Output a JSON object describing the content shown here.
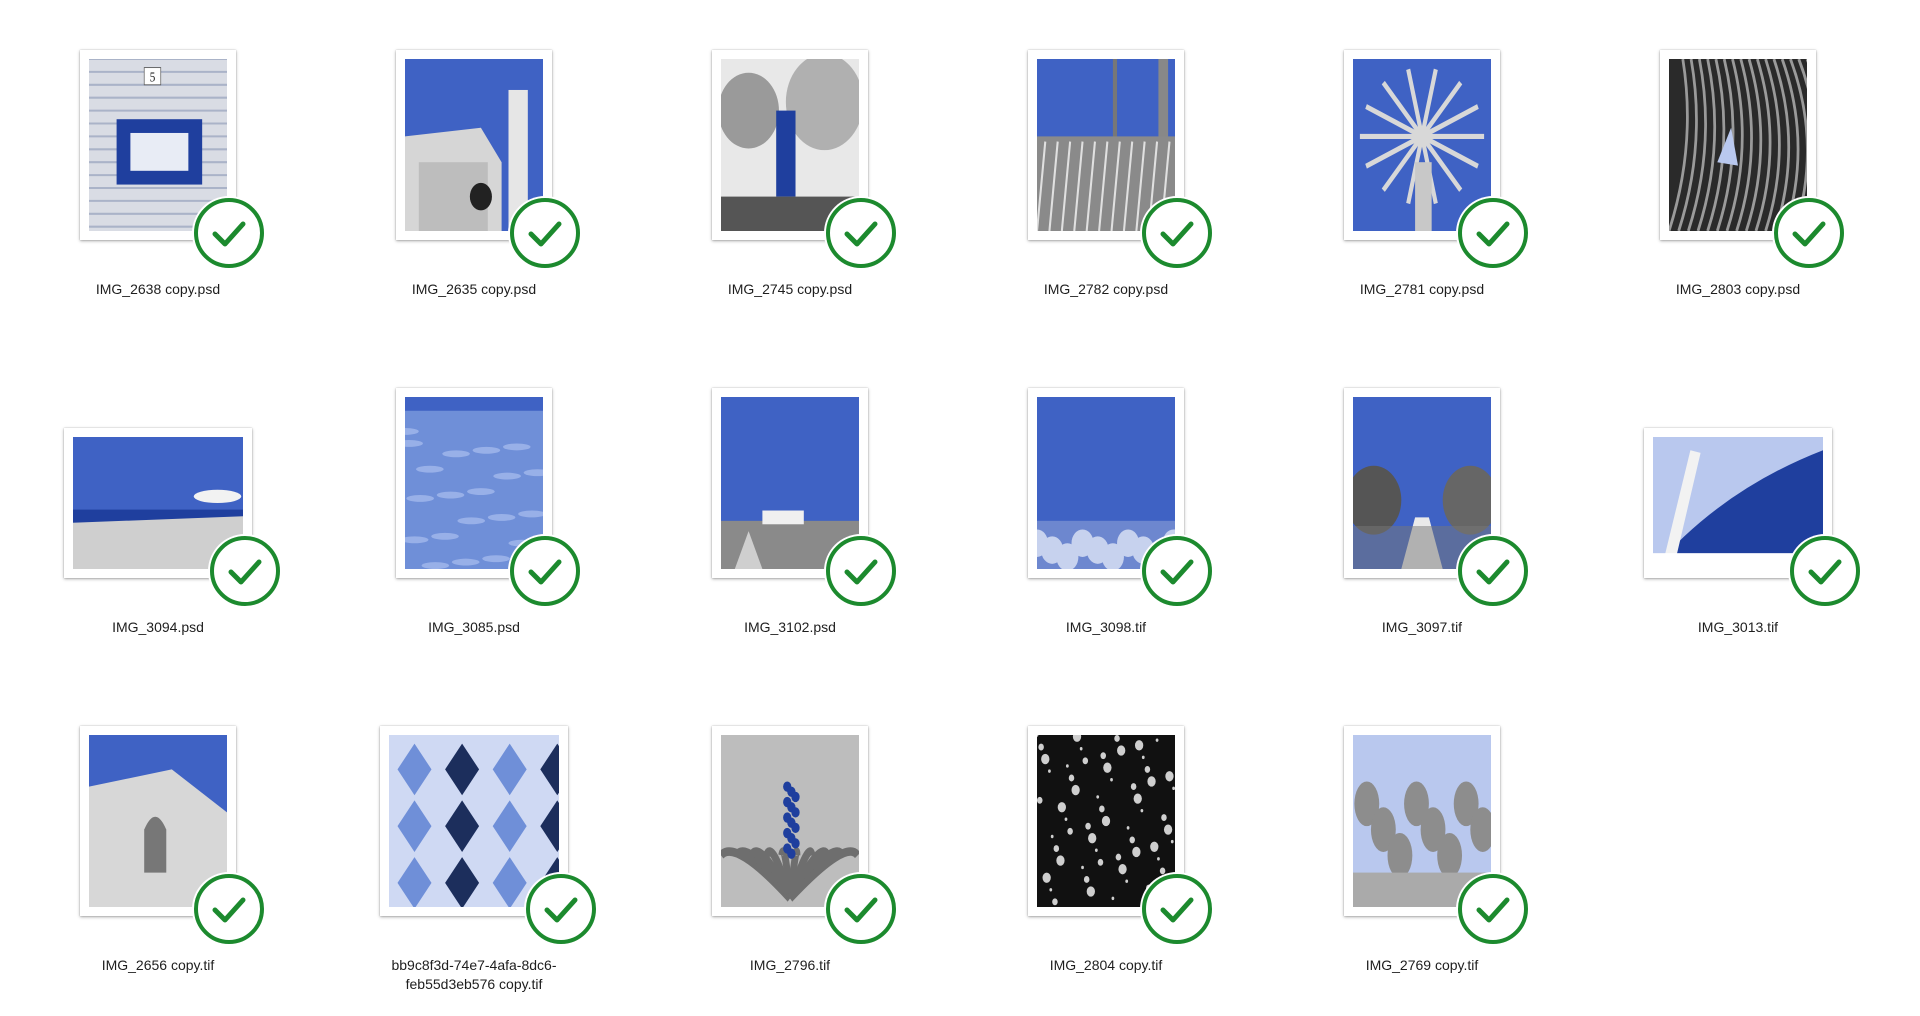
{
  "files": [
    {
      "name": "IMG_2638 copy.psd",
      "shape": "portrait",
      "scene": "tile-wall",
      "status": "checked"
    },
    {
      "name": "IMG_2635 copy.psd",
      "shape": "portrait",
      "scene": "church",
      "status": "checked"
    },
    {
      "name": "IMG_2745 copy.psd",
      "shape": "portrait",
      "scene": "lift-trees",
      "status": "checked"
    },
    {
      "name": "IMG_2782 copy.psd",
      "shape": "portrait",
      "scene": "agave-garden",
      "status": "checked"
    },
    {
      "name": "IMG_2781 copy.psd",
      "shape": "portrait",
      "scene": "palm-tree",
      "status": "checked"
    },
    {
      "name": "IMG_2803 copy.psd",
      "shape": "portrait",
      "scene": "leaves-dark",
      "status": "checked"
    },
    {
      "name": "IMG_3094.psd",
      "shape": "landscape",
      "scene": "beach",
      "status": "checked"
    },
    {
      "name": "IMG_3085.psd",
      "shape": "portrait",
      "scene": "water",
      "status": "checked"
    },
    {
      "name": "IMG_3102.psd",
      "shape": "portrait",
      "scene": "sky-town",
      "status": "checked"
    },
    {
      "name": "IMG_3098.tif",
      "shape": "portrait",
      "scene": "sky-shrubs",
      "status": "checked"
    },
    {
      "name": "IMG_3097.tif",
      "shape": "portrait",
      "scene": "path-trees",
      "status": "checked"
    },
    {
      "name": "IMG_3013.tif",
      "shape": "landscape",
      "scene": "architecture",
      "status": "checked"
    },
    {
      "name": "IMG_2656 copy.tif",
      "shape": "portrait",
      "scene": "gothic-wall",
      "status": "checked"
    },
    {
      "name": "bb9c8f3d-74e7-4afa-8dc6-\nfeb55d3eb576 copy.tif",
      "shape": "square",
      "scene": "cube-tiles",
      "status": "checked"
    },
    {
      "name": "IMG_2796.tif",
      "shape": "portrait",
      "scene": "bromeliad",
      "status": "checked"
    },
    {
      "name": "IMG_2804 copy.tif",
      "shape": "portrait",
      "scene": "gravel",
      "status": "checked"
    },
    {
      "name": "IMG_2769 copy.tif",
      "shape": "portrait",
      "scene": "cactus",
      "status": "checked"
    }
  ],
  "icons": {
    "status_badge": "checkmark-circle-icon"
  },
  "colors": {
    "badge_green": "#1c8a2e",
    "sky_blue": "#3f62c4",
    "deep_blue": "#1f3f9e",
    "light_blue": "#b9c8ee",
    "gray": "#9a9a9a"
  }
}
